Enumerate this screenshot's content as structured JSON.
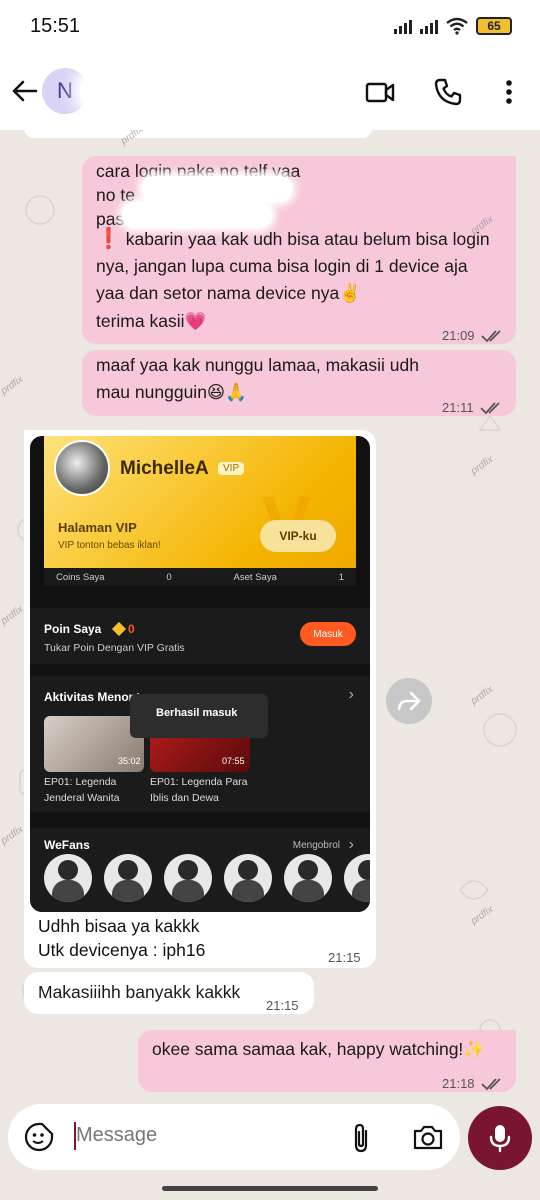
{
  "status_bar": {
    "time": "15:51",
    "battery": "65"
  },
  "header": {
    "avatar_initial": "N"
  },
  "messages": [
    {
      "lines": [
        "cara login pake no telf yaa",
        "no te",
        "pas"
      ],
      "time": "21:09"
    },
    {
      "line_warning": "kabarin yaa kak udh bisa atau belum bisa login nya, jangan lupa cuma bisa login di 1 device aja yaa dan setor nama device nya",
      "emoji_1": "✌️",
      "closing": "terima kasii",
      "emoji_2": "💗"
    },
    {
      "text": "maaf yaa kak nunggu lamaa, makasii udh mau nungguin",
      "emoji": "😆🙏",
      "time": "21:11"
    },
    {
      "caption_1": "Udhh bisaa ya kakkk",
      "caption_2": "Utk devicenya : iph16",
      "time": "21:15"
    },
    {
      "text": "Makasiiihh banyakk kakkk",
      "time": "21:15"
    },
    {
      "text": "okee sama samaa kak, happy watching!",
      "emoji": "✨",
      "time": "21:18"
    }
  ],
  "app_screenshot": {
    "username": "MichelleA",
    "vip_badge": "VIP",
    "vip_title": "Halaman VIP",
    "vip_sub": "VIP tonton bebas iklan!",
    "vip_button": "VIP-ku",
    "coins_label": "Coins Saya",
    "coins_value": "0",
    "assets_label": "Aset Saya",
    "assets_value": "1",
    "points_title": "Poin Saya",
    "points_value": "0",
    "points_sub": "Tukar Poin Dengan VIP Gratis",
    "masuk_button": "Masuk",
    "activity_title": "Aktivitas Menonton",
    "toast": "Berhasil masuk",
    "video_1_duration": "35:02",
    "video_1_title_a": "EP01: Legenda",
    "video_1_title_b": "Jenderal Wanita",
    "video_2_duration": "07:55",
    "video_2_title_a": "EP01: Legenda Para",
    "video_2_title_b": "Iblis dan Dewa",
    "wefans_title": "WeFans",
    "wefans_link": "Mengobrol"
  },
  "input": {
    "placeholder": "Message"
  },
  "watermark": "prdfix",
  "colors": {
    "outgoing": "#f7c8d9",
    "incoming": "#ffffff",
    "accent": "#7a1530"
  }
}
